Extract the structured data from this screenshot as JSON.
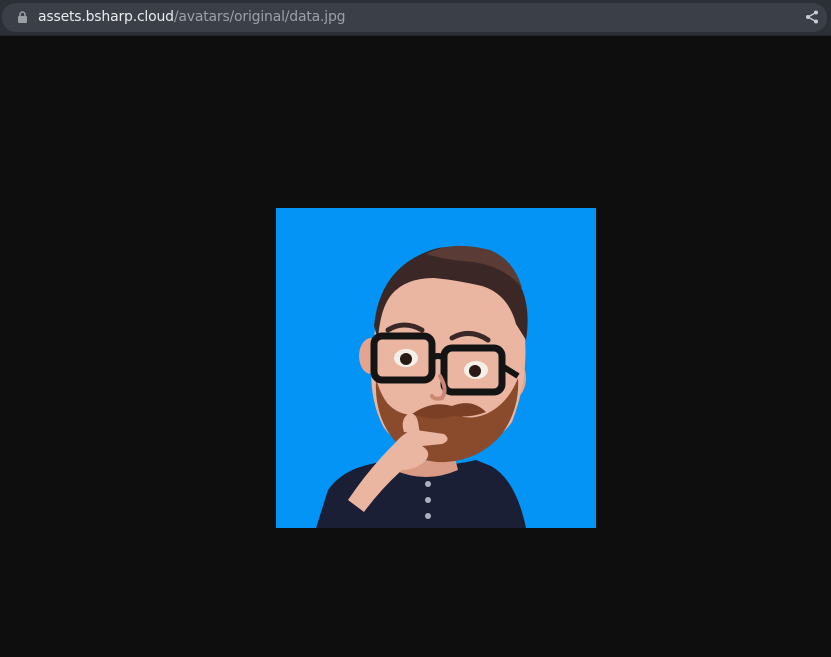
{
  "browser": {
    "address_bar": {
      "host": "assets.bsharp.cloud",
      "path": "/avatars/original/data.jpg",
      "lock_icon": "lock-icon",
      "share_icon": "share-icon"
    }
  },
  "viewer": {
    "background_color": "#0e0e0e",
    "image": {
      "subject": "cartoon avatar of bearded man with glasses",
      "background_color": "#0494f5"
    }
  }
}
